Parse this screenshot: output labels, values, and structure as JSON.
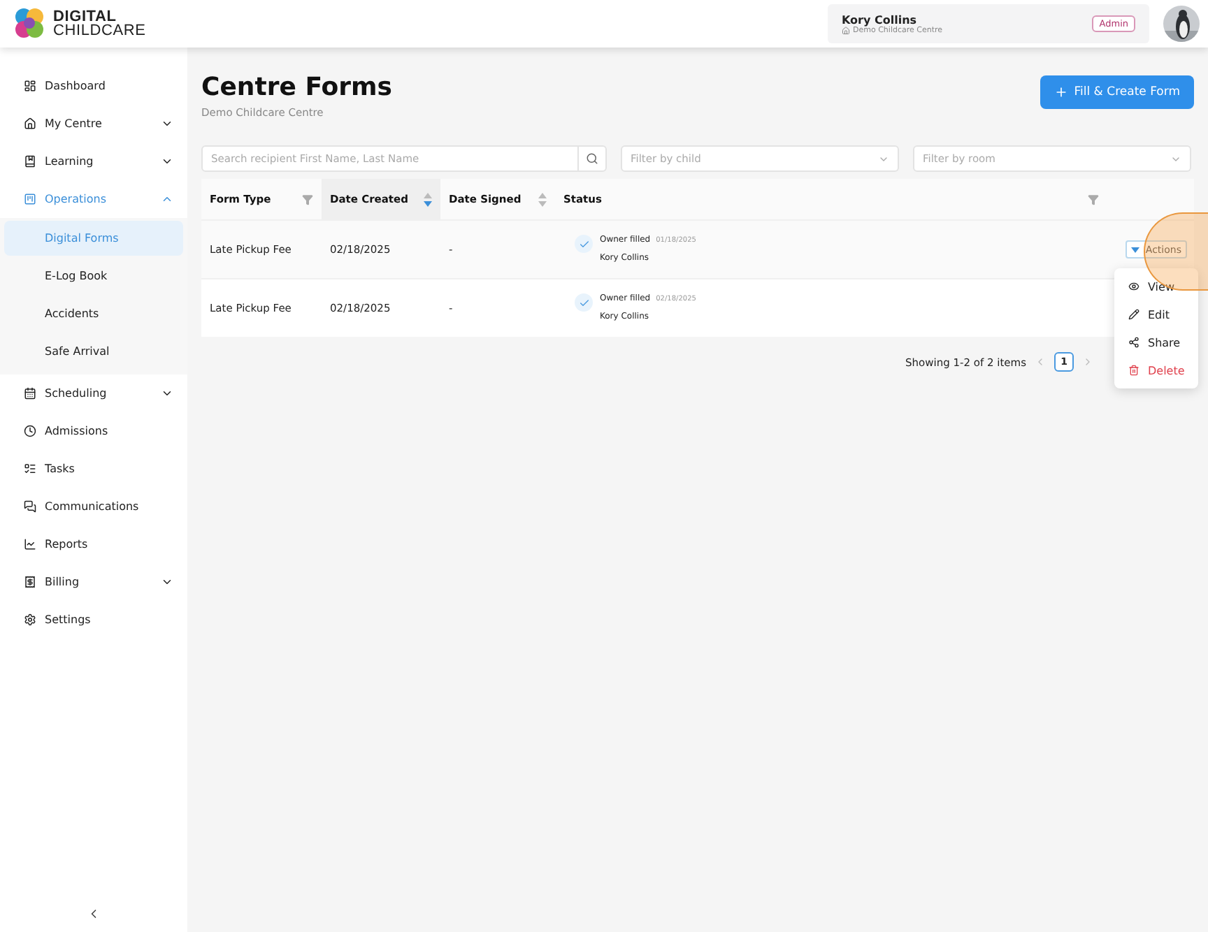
{
  "brand": {
    "line1": "DIGITAL",
    "line2": "CHILDCARE"
  },
  "user": {
    "name": "Kory Collins",
    "centre": "Demo Childcare Centre",
    "role": "Admin"
  },
  "sidebar": {
    "items": [
      {
        "label": "Dashboard",
        "selected": false
      },
      {
        "label": "My Centre",
        "selected": false,
        "expanded": false
      },
      {
        "label": "Learning",
        "selected": false,
        "expanded": false
      },
      {
        "label": "Operations",
        "selected": true,
        "expanded": true,
        "children": [
          {
            "label": "Digital Forms",
            "selected": true
          },
          {
            "label": "E-Log Book",
            "selected": false
          },
          {
            "label": "Accidents",
            "selected": false
          },
          {
            "label": "Safe Arrival",
            "selected": false
          }
        ]
      },
      {
        "label": "Scheduling",
        "selected": false,
        "expanded": false
      },
      {
        "label": "Admissions",
        "selected": false
      },
      {
        "label": "Tasks",
        "selected": false
      },
      {
        "label": "Communications",
        "selected": false
      },
      {
        "label": "Reports",
        "selected": false
      },
      {
        "label": "Billing",
        "selected": false,
        "expanded": false
      },
      {
        "label": "Settings",
        "selected": false
      }
    ]
  },
  "page": {
    "title": "Centre Forms",
    "subtitle": "Demo Childcare Centre",
    "create_button": "Fill & Create Form"
  },
  "filters": {
    "search": {
      "placeholder": "Search recipient First Name, Last Name"
    },
    "child": {
      "placeholder": "Filter by child"
    },
    "room": {
      "placeholder": "Filter by room"
    }
  },
  "table": {
    "columns": [
      {
        "label": "Form Type",
        "kind": "filter"
      },
      {
        "label": "Date Created",
        "kind": "sort",
        "sorted": true
      },
      {
        "label": "Date Signed",
        "kind": "sort",
        "sorted": false
      },
      {
        "label": "Status",
        "kind": "filter"
      }
    ],
    "rows": [
      {
        "form_type": "Late Pickup Fee",
        "date_created": "02/18/2025",
        "date_signed": "-",
        "status": {
          "label": "Owner filled",
          "date": "01/18/2025",
          "person": "Kory Collins"
        },
        "action": "Actions"
      },
      {
        "form_type": "Late Pickup Fee",
        "date_created": "02/18/2025",
        "date_signed": "-",
        "status": {
          "label": "Owner filled",
          "date": "02/18/2025",
          "person": "Kory Collins"
        }
      }
    ]
  },
  "actions_menu": [
    {
      "label": "View",
      "kind": "view"
    },
    {
      "label": "Edit",
      "kind": "edit"
    },
    {
      "label": "Share",
      "kind": "share"
    },
    {
      "label": "Delete",
      "kind": "delete"
    }
  ],
  "pagination": {
    "summary": "Showing 1-2 of 2 items",
    "pages": [
      {
        "label": "1",
        "selected": true
      }
    ]
  }
}
